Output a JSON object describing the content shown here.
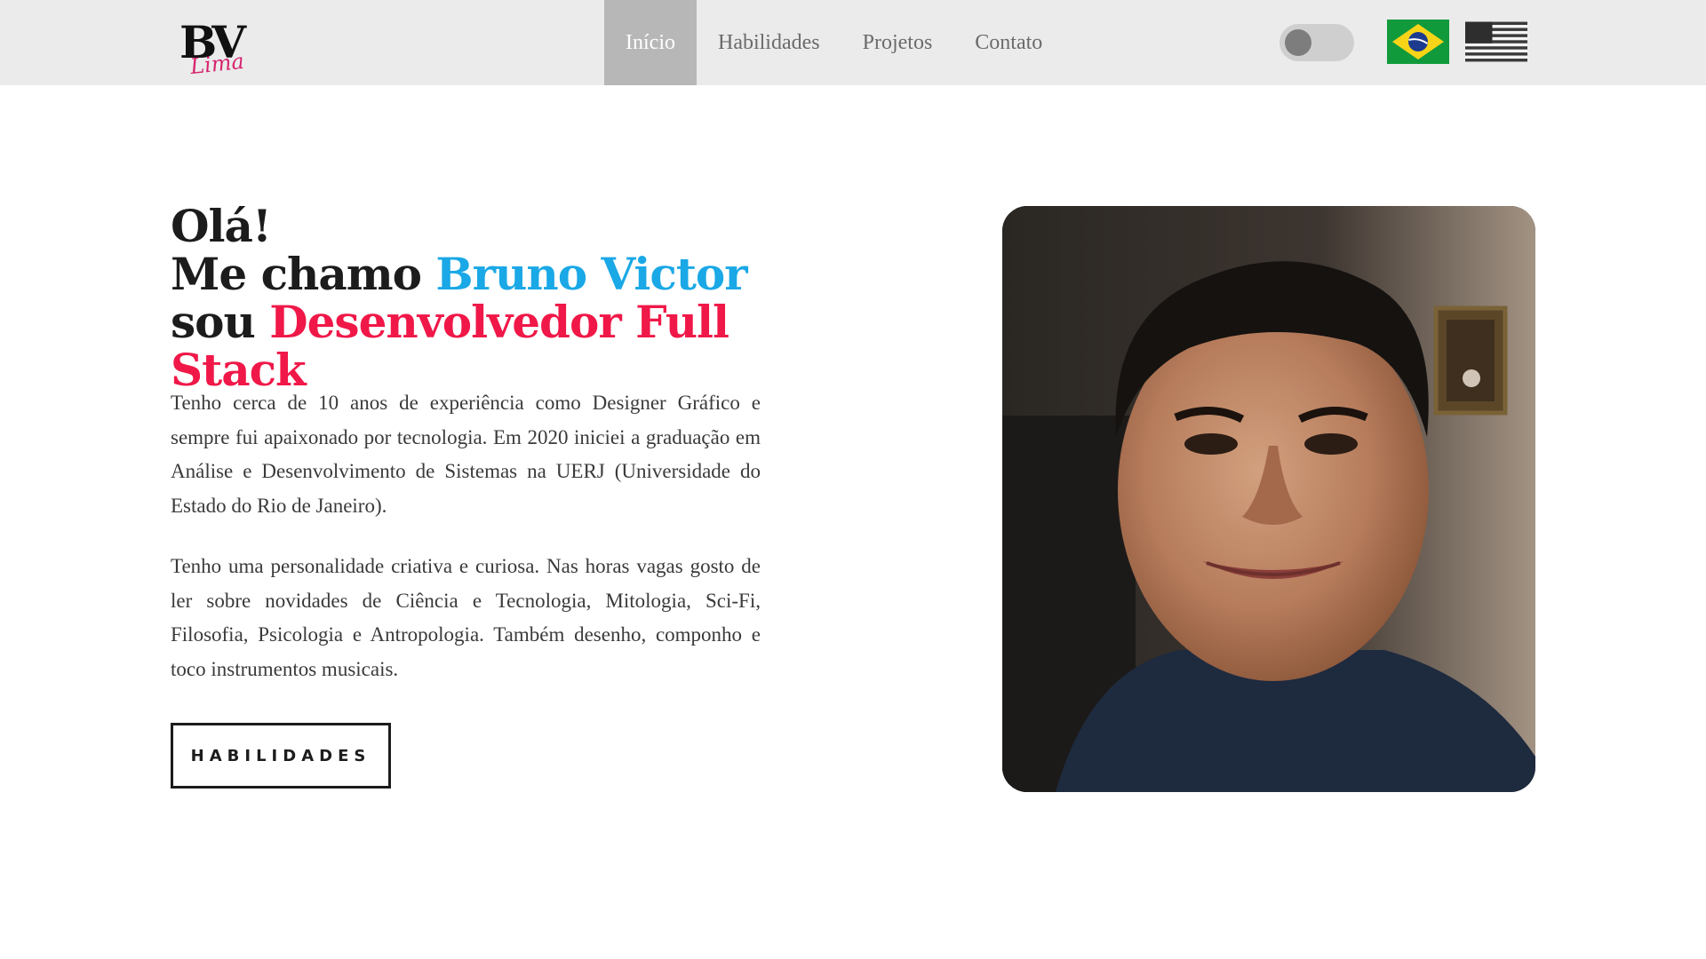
{
  "navbar": {
    "logo_text": "BV",
    "logo_subtext": "Lima",
    "items": [
      {
        "label": "Início",
        "active": true
      },
      {
        "label": "Habilidades",
        "active": false
      },
      {
        "label": "Projetos",
        "active": false
      },
      {
        "label": "Contato",
        "active": false
      }
    ],
    "theme_toggle_on": false,
    "languages": [
      "pt-BR",
      "en-US"
    ]
  },
  "hero": {
    "line1": "Olá!",
    "line2_prefix": "Me chamo ",
    "name": "Bruno Victor",
    "line3_prefix": "sou ",
    "role": "Desenvolvedor Full Stack",
    "paragraph1": "Tenho cerca de 10 anos de experiência como Designer Gráfico e sempre fui apaixonado por tecnologia. Em 2020 iniciei a graduação em Análise e Desenvolvimento de Sistemas na UERJ (Universidade do Estado do Rio de Janeiro).",
    "paragraph2": "Tenho uma personalidade criativa e curiosa. Nas horas vagas gosto de ler sobre novidades de Ciência e Tecnologia, Mitologia, Sci-Fi, Filosofia, Psicologia e Antropologia. Também desenho, componho e toco instrumentos musicais.",
    "button_label": "HABILIDADES"
  },
  "colors": {
    "accent_blue": "#1aa8e6",
    "accent_red": "#f01848",
    "navbar_bg": "#ebebeb",
    "nav_active_bg": "#b7b7b7"
  }
}
